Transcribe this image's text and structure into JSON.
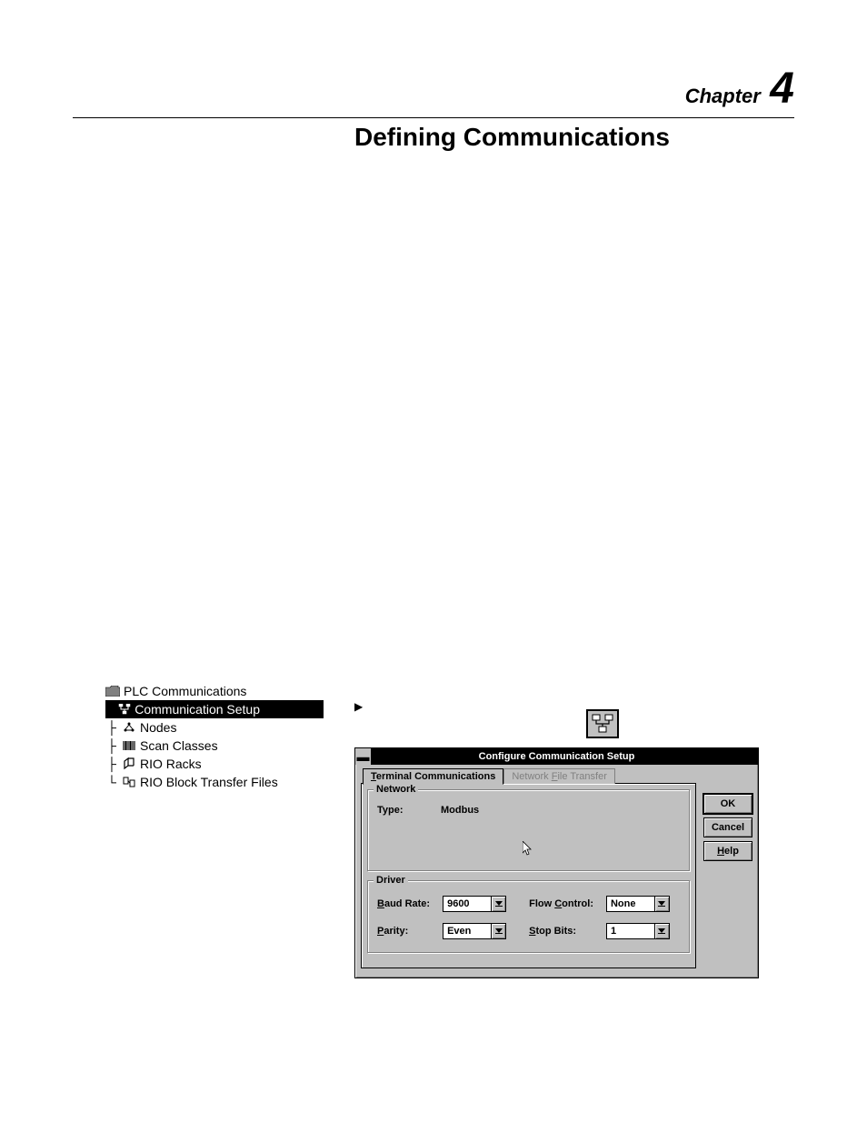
{
  "header": {
    "chapter_label": "Chapter",
    "chapter_number": "4"
  },
  "title": "Defining Communications",
  "tree": {
    "root": "PLC Communications",
    "items": [
      "Communication Setup",
      "Nodes",
      "Scan Classes",
      "RIO Racks",
      "RIO Block Transfer Files"
    ]
  },
  "arrow": "▶",
  "dialog": {
    "title": "Configure Communication Setup",
    "tabs": {
      "active": "Terminal Communications",
      "inactive": "Network File Transfer"
    },
    "network": {
      "group_label": "Network",
      "type_label": "Type:",
      "type_value": "Modbus"
    },
    "driver": {
      "group_label": "Driver",
      "baud_label": "Baud Rate:",
      "baud_value": "9600",
      "flow_label": "Flow Control:",
      "flow_value": "None",
      "parity_label": "Parity:",
      "parity_value": "Even",
      "stop_label": "Stop Bits:",
      "stop_value": "1"
    },
    "buttons": {
      "ok": "OK",
      "cancel": "Cancel",
      "help": "Help"
    }
  }
}
